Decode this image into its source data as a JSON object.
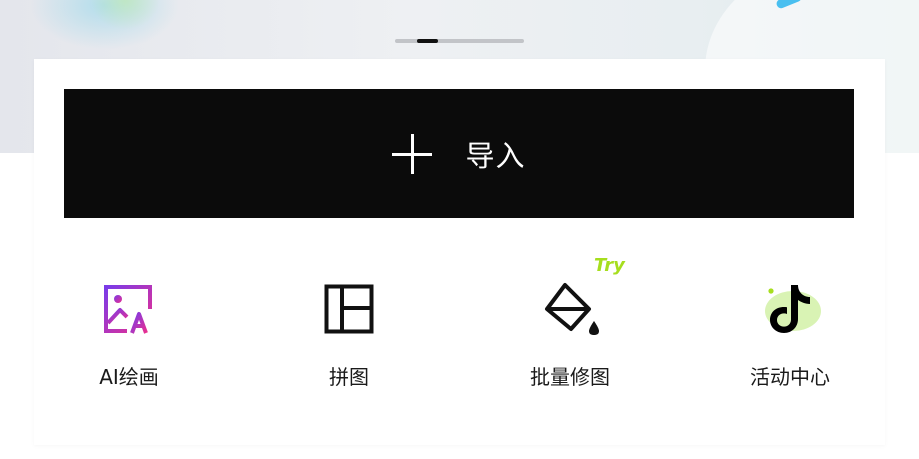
{
  "banner": {
    "pager": {
      "total": 6,
      "active_index": 1
    }
  },
  "import": {
    "label": "导入",
    "icon": "plus-icon"
  },
  "tools": [
    {
      "label": "AI绘画",
      "icon": "ai-image-icon"
    },
    {
      "label": "拼图",
      "icon": "collage-grid-icon"
    },
    {
      "label": "批量修图",
      "icon": "paint-bucket-icon",
      "badge": "Try"
    },
    {
      "label": "活动中心",
      "icon": "tiktok-logo-icon"
    }
  ],
  "colors": {
    "import_bg": "#0b0b0b",
    "badge": "#a6de1e",
    "ai_gradient_start": "#8b33e6",
    "ai_gradient_end": "#e6349a"
  }
}
